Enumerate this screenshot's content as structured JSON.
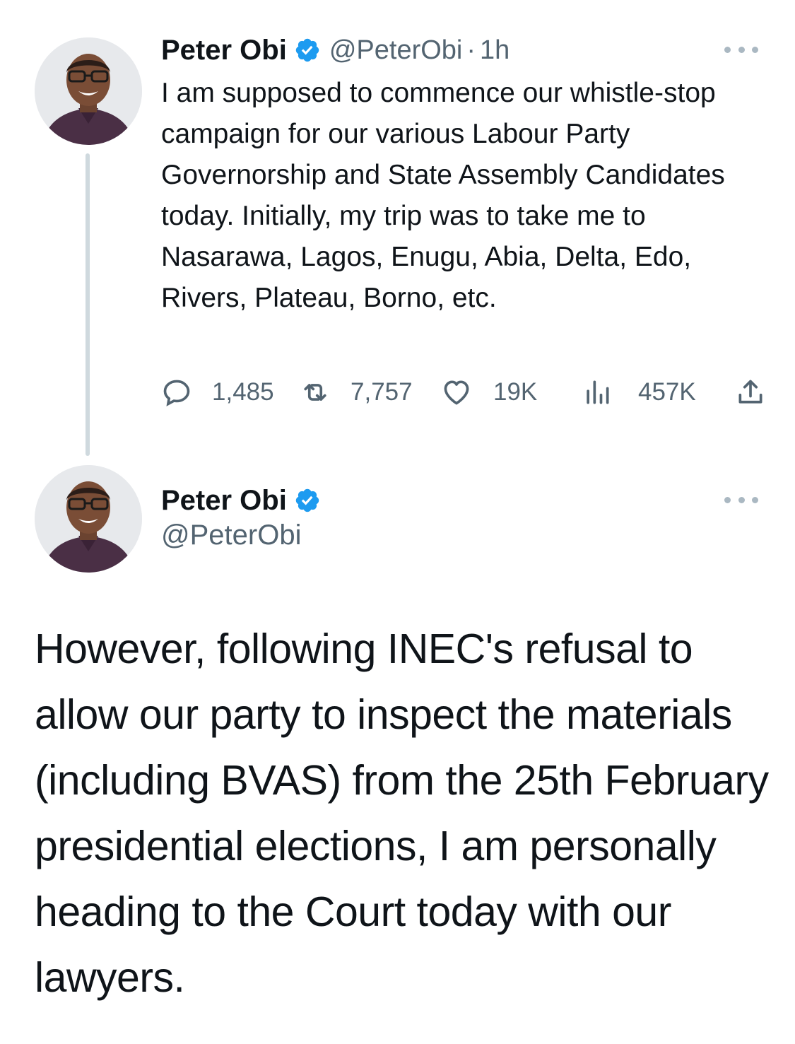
{
  "tweet1": {
    "author_name": "Peter Obi",
    "handle": "@PeterObi",
    "separator": "·",
    "time": "1h",
    "text": "I am supposed to commence our whistle-stop campaign for our various Labour Party Governorship and State Assembly Candidates today. Initially, my trip was to take me to Nasarawa, Lagos, Enugu, Abia, Delta, Edo, Rivers, Plateau, Borno, etc.",
    "replies": "1,485",
    "retweets": "7,757",
    "likes": "19K",
    "views": "457K"
  },
  "tweet2": {
    "author_name": "Peter Obi",
    "handle": "@PeterObi",
    "text": "However, following INEC's refusal to allow our party to inspect the materials (including BVAS) from the 25th February presidential elections, I am personally heading to the Court today with our lawyers."
  },
  "icons": {
    "verified": "verified-badge-icon",
    "more": "more-options-icon",
    "reply": "reply-icon",
    "retweet": "retweet-icon",
    "like": "heart-icon",
    "views": "views-chart-icon",
    "share": "share-icon"
  },
  "colors": {
    "text_primary": "#0f1419",
    "text_secondary": "#536471",
    "verified_blue": "#1d9bf0",
    "thread_line": "#cfd9de"
  }
}
